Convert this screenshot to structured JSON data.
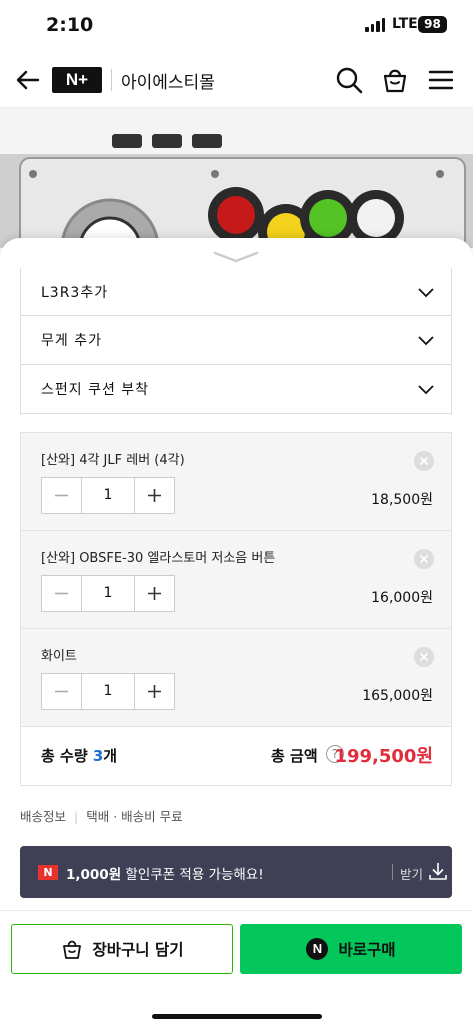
{
  "status_bar": {
    "time": "2:10",
    "network": "LTE",
    "battery": "98"
  },
  "nav": {
    "logo": "N+",
    "store_name": "아이에스티몰"
  },
  "options": [
    {
      "label": "L3R3추가"
    },
    {
      "label": "무게 추가"
    },
    {
      "label": "스펀지 쿠션 부착"
    }
  ],
  "selected_items": [
    {
      "name": "[산와] 4각 JLF 레버 (4각)",
      "qty": "1",
      "price": "18,500원"
    },
    {
      "name": "[산와] OBSFE-30 엘라스토머 저소음 버튼",
      "qty": "1",
      "price": "16,000원"
    },
    {
      "name": "화이트",
      "qty": "1",
      "price": "165,000원"
    }
  ],
  "total": {
    "qty_label": "총 수량",
    "qty_value": "3",
    "qty_unit": "개",
    "amount_label": "총 금액",
    "help": "?",
    "amount": "199,500원"
  },
  "delivery": {
    "label": "배송정보",
    "value": "택배 · 배송비 무료"
  },
  "coupon": {
    "badge": "N",
    "amount": "1,000원",
    "text": "할인쿠폰 적용 가능해요!",
    "action": "받기"
  },
  "actions": {
    "cart_label": "장바구니 담기",
    "buy_badge": "N",
    "buy_label": "바로구매"
  },
  "colors": {
    "accent_green": "#03c75a",
    "price_red": "#e02d3c",
    "coupon_bg": "#3f4055",
    "count_blue": "#1a6fd6"
  }
}
